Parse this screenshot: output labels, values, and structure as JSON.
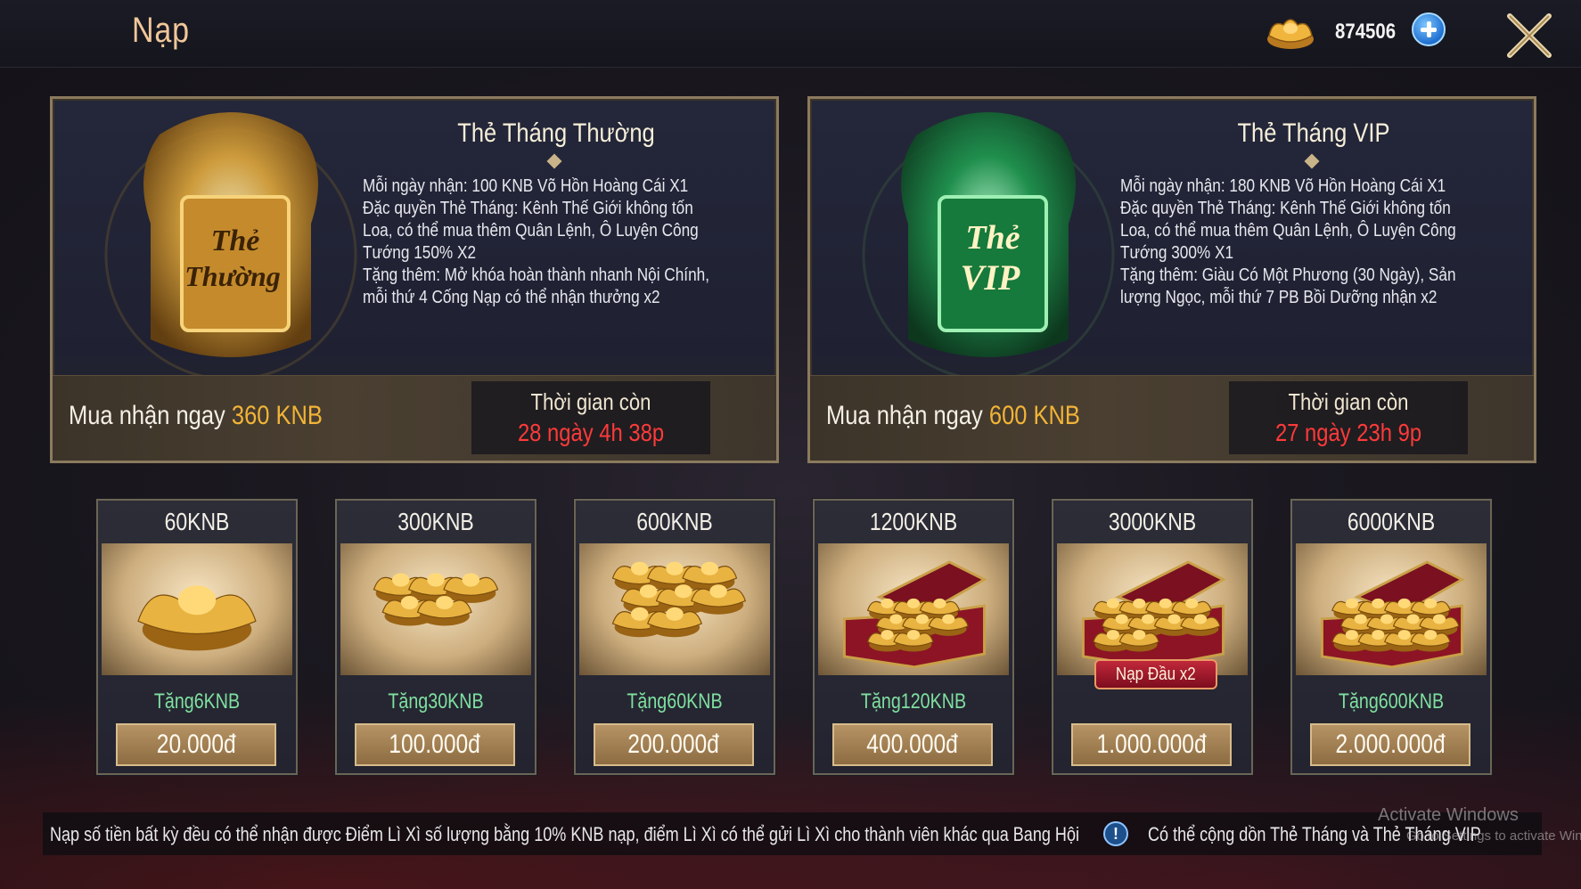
{
  "header": {
    "title": "Nạp",
    "currency_value": "874506",
    "currency_icon": "gold-ingot-icon",
    "add_icon": "plus-icon",
    "close_icon": "close-x-icon"
  },
  "monthly_cards": [
    {
      "id": "normal",
      "title": "Thẻ Tháng Thường",
      "art_text_line1": "Thẻ",
      "art_text_line2": "Thường",
      "description": "Mỗi ngày nhận: 100 KNB   Võ Hồn Hoàng Cái X1\nĐặc quyền Thẻ Tháng: Kênh Thế Giới không tốn Loa, có thể mua thêm Quân Lệnh, Ô Luyện Công Tướng 150% X2\nTặng thêm: Mở khóa hoàn thành nhanh Nội Chính, mỗi thứ 4 Cống Nạp có thể nhận thưởng x2",
      "buy_prefix": "Mua nhận ngay ",
      "buy_amount": "360 KNB",
      "time_label": "Thời gian còn",
      "time_value": "28 ngày 4h 38p"
    },
    {
      "id": "vip",
      "title": "Thẻ Tháng VIP",
      "art_text_line1": "Thẻ",
      "art_text_line2": "VIP",
      "description": "Mỗi ngày nhận: 180 KNB   Võ Hồn Hoàng Cái X1\nĐặc quyền Thẻ Tháng: Kênh Thế Giới không tốn Loa, có thể mua thêm Quân Lệnh, Ô Luyện Công Tướng 300% X1\nTặng thêm: Giàu Có Một Phương (30 Ngày), Sản lượng Ngọc, mỗi thứ 7 PB Bồi Dưỡng nhận x2",
      "buy_prefix": "Mua nhận ngay ",
      "buy_amount": "600 KNB",
      "time_label": "Thời gian còn",
      "time_value": "27 ngày 23h 9p"
    }
  ],
  "packs": [
    {
      "name": "60KNB",
      "bonus": "Tặng6KNB",
      "price": "20.000đ",
      "ingots": 1,
      "chest": false
    },
    {
      "name": "300KNB",
      "bonus": "Tặng30KNB",
      "price": "100.000đ",
      "ingots": 5,
      "chest": false
    },
    {
      "name": "600KNB",
      "bonus": "Tặng60KNB",
      "price": "200.000đ",
      "ingots": 8,
      "chest": false
    },
    {
      "name": "1200KNB",
      "bonus": "Tặng120KNB",
      "price": "400.000đ",
      "ingots": 8,
      "chest": true
    },
    {
      "name": "3000KNB",
      "bonus": "",
      "badge": "Nạp Đầu x2",
      "price": "1.000.000đ",
      "ingots": 10,
      "chest": true
    },
    {
      "name": "6000KNB",
      "bonus": "Tặng600KNB",
      "price": "2.000.000đ",
      "ingots": 12,
      "chest": true
    }
  ],
  "notice": {
    "text": "Nạp số tiền bất kỳ đều có thể nhận được Điểm Lì Xì số lượng bằng 10% KNB nạp, điểm Lì Xì có thể gửi Lì Xì cho thành viên khác qua Bang Hội",
    "icon": "!",
    "text2": "Có thể cộng dồn Thẻ Tháng và Thẻ Tháng VIP"
  },
  "watermark": {
    "line1": "Activate Windows",
    "line2": "Go to Settings to activate Windows"
  },
  "colors": {
    "accent_gold": "#f2b437",
    "timer_red": "#ff3a3a",
    "bonus_green": "#7fe0a0",
    "vip_green": "#1f9a4f"
  }
}
